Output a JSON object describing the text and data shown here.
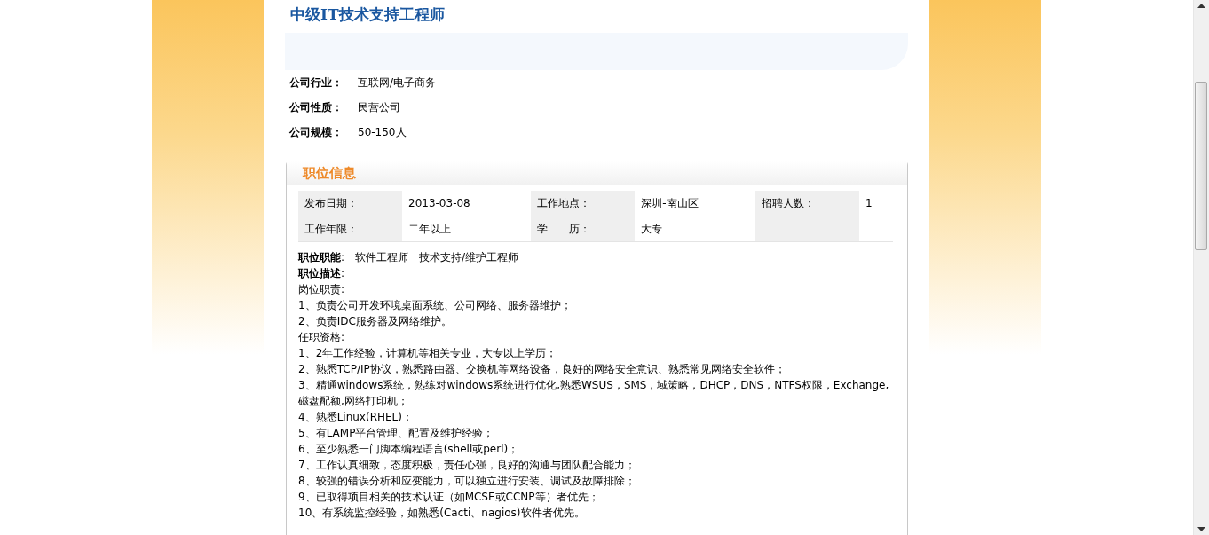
{
  "title": "中级IT技术支持工程师",
  "company": [
    {
      "label": "公司行业：",
      "value": "互联网/电子商务"
    },
    {
      "label": "公司性质：",
      "value": "民营公司"
    },
    {
      "label": "公司规模：",
      "value": "50-150人"
    }
  ],
  "section": {
    "title": "职位信息"
  },
  "info_table": {
    "rows": [
      [
        {
          "label": "发布日期：",
          "value": "2013-03-08"
        },
        {
          "label": "工作地点：",
          "value": "深圳-南山区"
        },
        {
          "label": "招聘人数：",
          "value": "1"
        }
      ],
      [
        {
          "label": "工作年限：",
          "value": "二年以上"
        },
        {
          "label": "学　　历：",
          "value": "大专"
        }
      ]
    ]
  },
  "job_function": {
    "label": "**职位职能**:",
    "values": [
      "软件工程师",
      "技术支持/维护工程师"
    ]
  },
  "description": {
    "label": "**职位描述**:",
    "lines": [
      "岗位职责:",
      "1、负责公司开发环境桌面系统、公司网络、服务器维护；",
      "2、负责IDC服务器及网络维护。",
      "任职资格:",
      "1、2年工作经验，计算机等相关专业，大专以上学历；",
      "2、熟悉TCP/IP协议，熟悉路由器、交换机等网络设备，良好的网络安全意识、熟悉常见网络安全软件；",
      "3、精通windows系统，熟练对windows系统进行优化,熟悉WSUS，SMS，域策略，DHCP，DNS，NTFS权限，Exchange,磁盘配额,网络打印机；",
      "4、熟悉Linux(RHEL)；",
      "5、有LAMP平台管理、配置及维护经验；",
      "6、至少熟悉一门脚本编程语言(shell或perl)；",
      "7、工作认真细致，态度积极，责任心强，良好的沟通与团队配合能力；",
      "8、较强的错误分析和应变能力，可以独立进行安装、调试及故障排除；",
      "9、已取得项目相关的技术认证（如MCSE或CCNP等）者优先；",
      "10、有系统监控经验，如熟悉(Cacti、nagios)软件者优先。"
    ]
  }
}
